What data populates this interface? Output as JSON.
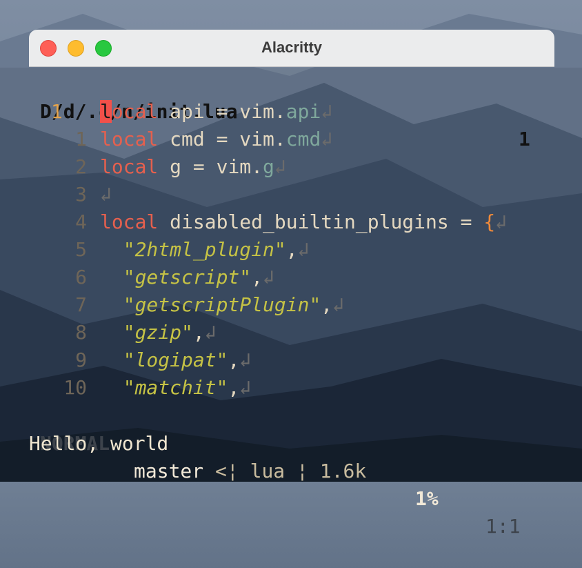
{
  "window": {
    "title": "Alacritty"
  },
  "tabline": {
    "file": "D/d/.c/n/init.lua",
    "count": "1"
  },
  "lines": [
    {
      "num": "1",
      "current": true,
      "parts": [
        {
          "t": "l",
          "c": "cursor"
        },
        {
          "t": "ocal",
          "c": "kw"
        },
        {
          "t": " api = vim.",
          "c": ""
        },
        {
          "t": "api",
          "c": "mem"
        },
        {
          "t": "↲",
          "c": "nl"
        }
      ]
    },
    {
      "num": "1",
      "parts": [
        {
          "t": "local",
          "c": "kw"
        },
        {
          "t": " cmd = vim.",
          "c": ""
        },
        {
          "t": "cmd",
          "c": "mem"
        },
        {
          "t": "↲",
          "c": "nl"
        }
      ]
    },
    {
      "num": "2",
      "parts": [
        {
          "t": "local",
          "c": "kw"
        },
        {
          "t": " g = vim.",
          "c": ""
        },
        {
          "t": "g",
          "c": "mem"
        },
        {
          "t": "↲",
          "c": "nl"
        }
      ]
    },
    {
      "num": "3",
      "parts": [
        {
          "t": "↲",
          "c": "nl"
        }
      ]
    },
    {
      "num": "4",
      "parts": [
        {
          "t": "local",
          "c": "kw"
        },
        {
          "t": " disabled_builtin_plugins = ",
          "c": ""
        },
        {
          "t": "{",
          "c": "brace"
        },
        {
          "t": "↲",
          "c": "nl"
        }
      ]
    },
    {
      "num": "5",
      "parts": [
        {
          "t": "  ",
          "c": ""
        },
        {
          "t": "\"2html_plugin\"",
          "c": "str"
        },
        {
          "t": ",",
          "c": ""
        },
        {
          "t": "↲",
          "c": "nl"
        }
      ]
    },
    {
      "num": "6",
      "parts": [
        {
          "t": "  ",
          "c": ""
        },
        {
          "t": "\"getscript\"",
          "c": "str"
        },
        {
          "t": ",",
          "c": ""
        },
        {
          "t": "↲",
          "c": "nl"
        }
      ]
    },
    {
      "num": "7",
      "parts": [
        {
          "t": "  ",
          "c": ""
        },
        {
          "t": "\"getscriptPlugin\"",
          "c": "str"
        },
        {
          "t": ",",
          "c": ""
        },
        {
          "t": "↲",
          "c": "nl"
        }
      ]
    },
    {
      "num": "8",
      "parts": [
        {
          "t": "  ",
          "c": ""
        },
        {
          "t": "\"gzip\"",
          "c": "str"
        },
        {
          "t": ",",
          "c": ""
        },
        {
          "t": "↲",
          "c": "nl"
        }
      ]
    },
    {
      "num": "9",
      "parts": [
        {
          "t": "  ",
          "c": ""
        },
        {
          "t": "\"logipat\"",
          "c": "str"
        },
        {
          "t": ",",
          "c": ""
        },
        {
          "t": "↲",
          "c": "nl"
        }
      ]
    },
    {
      "num": "10",
      "parts": [
        {
          "t": "  ",
          "c": ""
        },
        {
          "t": "\"matchit\"",
          "c": "str"
        },
        {
          "t": ",",
          "c": ""
        },
        {
          "t": "↲",
          "c": "nl"
        }
      ]
    }
  ],
  "statusline": {
    "mode": "NORMAL",
    "branch": "master",
    "sep1": " <",
    "bar": "¦",
    "filetype": " lua ",
    "size": " 1.6k",
    "percent": "1%",
    "position": "1:1"
  },
  "cmdline": {
    "text": "Hello, world"
  },
  "colors": {
    "keyword": "#e5604e",
    "member": "#7fa89c",
    "string": "#c5c245",
    "brace": "#f08a3a",
    "cursor": "#f2504a",
    "current_line_number": "#e5a34a"
  }
}
